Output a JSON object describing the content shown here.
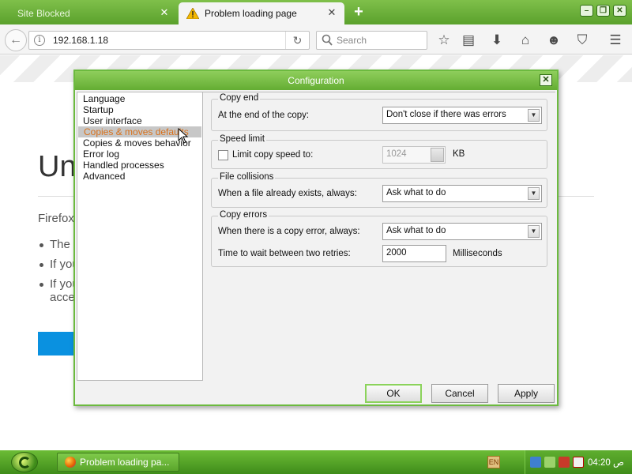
{
  "browser": {
    "tabs": [
      {
        "label": "Site Blocked",
        "active": false
      },
      {
        "label": "Problem loading page",
        "active": true
      }
    ],
    "new_tab_label": "+",
    "url": "192.168.1.18",
    "search_placeholder": "Search"
  },
  "error_page": {
    "title_fragment": "Un",
    "intro_fragment": "Firefox",
    "bullets": [
      "The",
      "If you",
      "If you"
    ],
    "bullet_continuation": "acce"
  },
  "dialog": {
    "title": "Configuration",
    "nav_items": [
      "Language",
      "Startup",
      "User interface",
      "Copies & moves defaults",
      "Copies & moves behavior",
      "Error log",
      "Handled processes",
      "Advanced"
    ],
    "selected_nav_index": 3,
    "groups": {
      "copy_end": {
        "title": "Copy end",
        "label": "At the end of the copy:",
        "value": "Don't close if there was errors"
      },
      "speed_limit": {
        "title": "Speed limit",
        "checkbox_label": "Limit copy speed to:",
        "checked": false,
        "value": "1024",
        "unit": "KB"
      },
      "file_collisions": {
        "title": "File collisions",
        "label": "When a file already exists, always:",
        "value": "Ask what to do"
      },
      "copy_errors": {
        "title": "Copy errors",
        "label": "When there is a copy error, always:",
        "value": "Ask what to do",
        "retry_label": "Time to wait between two retries:",
        "retry_value": "2000",
        "retry_unit": "Milliseconds"
      }
    },
    "buttons": {
      "ok": "OK",
      "cancel": "Cancel",
      "apply": "Apply"
    }
  },
  "taskbar": {
    "task_label": "Problem loading pa...",
    "language_indicator": "EN",
    "clock": "04:20 ص"
  },
  "colors": {
    "accent_green": "#6cba3f",
    "selection_text": "#d8701a",
    "link_button": "#0a91e0"
  }
}
